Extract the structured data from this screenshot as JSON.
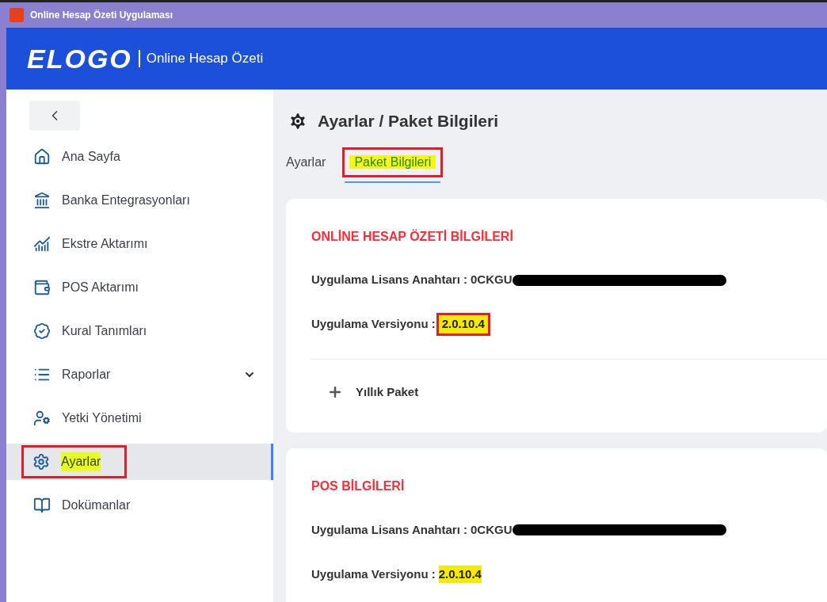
{
  "window": {
    "title": "Online Hesap Özeti Uygulaması"
  },
  "header": {
    "logo": "ELOGO",
    "product": "Online Hesap Özeti"
  },
  "sidebar": {
    "items": [
      {
        "label": "Ana Sayfa",
        "kind": "link",
        "selected": false,
        "annotated": false
      },
      {
        "label": "Banka Entegrasyonları",
        "kind": "link",
        "selected": false,
        "annotated": false
      },
      {
        "label": "Ekstre Aktarımı",
        "kind": "link",
        "selected": false,
        "annotated": false
      },
      {
        "label": "POS Aktarımı",
        "kind": "link",
        "selected": false,
        "annotated": false
      },
      {
        "label": "Kural Tanımları",
        "kind": "link",
        "selected": false,
        "annotated": false
      },
      {
        "label": "Raporlar",
        "kind": "group",
        "selected": false,
        "annotated": false
      },
      {
        "label": "Yetki Yönetimi",
        "kind": "link",
        "selected": false,
        "annotated": false
      },
      {
        "label": "Ayarlar",
        "kind": "link",
        "selected": true,
        "annotated": true
      },
      {
        "label": "Dokümanlar",
        "kind": "link",
        "selected": false,
        "annotated": false
      }
    ]
  },
  "page": {
    "title": "Ayarlar / Paket Bilgileri",
    "tabs": [
      {
        "label": "Ayarlar",
        "selected": false,
        "annotated": false
      },
      {
        "label": "Paket Bilgileri",
        "selected": true,
        "annotated": true
      }
    ],
    "cards": [
      {
        "title": "ONLİNE HESAP ÖZETİ BİLGİLERİ",
        "fields": [
          {
            "label": "Uygulama Lisans Anahtarı :",
            "value": "0CKGU",
            "redacted": true,
            "annotated": false
          },
          {
            "label": "Uygulama Versiyonu :",
            "value": "2.0.10.4",
            "redacted": false,
            "annotated": true
          }
        ],
        "package": {
          "label": "Yıllık Paket",
          "expanded": false
        }
      },
      {
        "title": "POS BİLGİLERİ",
        "fields": [
          {
            "label": "Uygulama Lisans Anahtarı :",
            "value": "0CKGU",
            "redacted": true,
            "annotated": false
          },
          {
            "label": "Uygulama Versiyonu :",
            "value": "2.0.10.4",
            "redacted": false,
            "annotated": false
          }
        ]
      }
    ]
  }
}
